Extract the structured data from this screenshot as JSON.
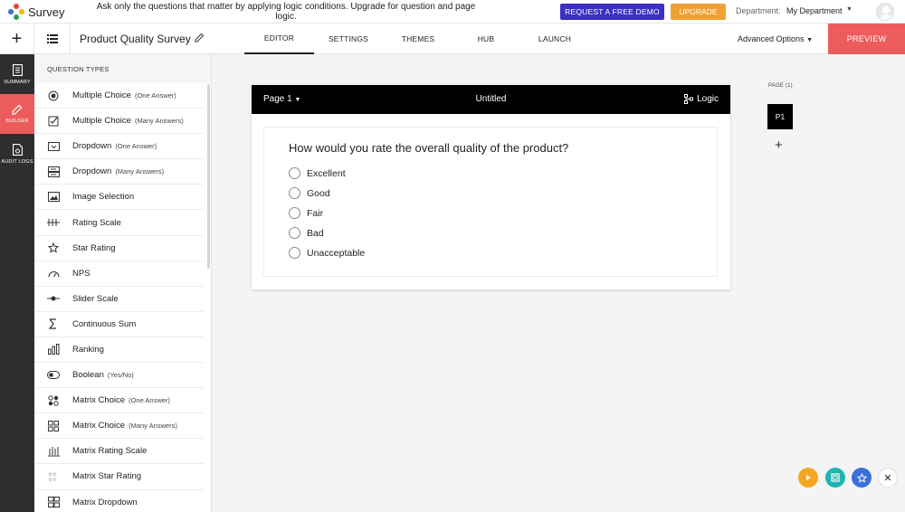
{
  "app": {
    "name": "Survey"
  },
  "topbar": {
    "promo": "Ask only the questions that matter by applying logic conditions. Upgrade for question and page logic.",
    "demo_button": "REQUEST A FREE DEMO",
    "upgrade_button": "UPGRADE",
    "department_label": "Department:",
    "department_value": "My Department"
  },
  "nav": {
    "survey_title": "Product Quality Survey",
    "tabs": [
      "EDITOR",
      "SETTINGS",
      "THEMES",
      "HUB",
      "LAUNCH"
    ],
    "active_tab": "EDITOR",
    "advanced_options": "Advanced Options",
    "preview": "PREVIEW"
  },
  "leftbar": {
    "items": [
      {
        "label": "SUMMARY",
        "icon": "document-icon"
      },
      {
        "label": "BUILDER",
        "icon": "pencil-icon"
      },
      {
        "label": "AUDIT LOGS",
        "icon": "log-file-icon"
      }
    ]
  },
  "question_types": {
    "header": "QUESTION TYPES",
    "items": [
      {
        "label": "Multiple Choice",
        "sub": "(One Answer)",
        "icon": "radio-icon"
      },
      {
        "label": "Multiple Choice",
        "sub": "(Many Answers)",
        "icon": "checkbox-icon"
      },
      {
        "label": "Dropdown",
        "sub": "(One Answer)",
        "icon": "dropdown-icon"
      },
      {
        "label": "Dropdown",
        "sub": "(Many Answers)",
        "icon": "multi-dropdown-icon"
      },
      {
        "label": "Image Selection",
        "sub": "",
        "icon": "image-icon"
      },
      {
        "label": "Rating Scale",
        "sub": "",
        "icon": "rating-scale-icon"
      },
      {
        "label": "Star Rating",
        "sub": "",
        "icon": "star-icon"
      },
      {
        "label": "NPS",
        "sub": "",
        "icon": "gauge-icon"
      },
      {
        "label": "Slider Scale",
        "sub": "",
        "icon": "slider-icon"
      },
      {
        "label": "Continuous Sum",
        "sub": "",
        "icon": "sigma-icon"
      },
      {
        "label": "Ranking",
        "sub": "",
        "icon": "ranking-icon"
      },
      {
        "label": "Boolean",
        "sub": "(Yes/No)",
        "icon": "toggle-icon"
      },
      {
        "label": "Matrix Choice",
        "sub": "(One Answer)",
        "icon": "matrix-radio-icon"
      },
      {
        "label": "Matrix Choice",
        "sub": "(Many Answers)",
        "icon": "matrix-checkbox-icon"
      },
      {
        "label": "Matrix Rating Scale",
        "sub": "",
        "icon": "matrix-rating-icon"
      },
      {
        "label": "Matrix Star Rating",
        "sub": "",
        "icon": "matrix-star-icon"
      },
      {
        "label": "Matrix Dropdown",
        "sub": "",
        "icon": "matrix-dropdown-icon"
      }
    ]
  },
  "editor": {
    "page_selector": "Page 1",
    "page_title": "Untitled",
    "logic": "Logic",
    "question": "How would you rate the overall quality of the product?",
    "options": [
      "Excellent",
      "Good",
      "Fair",
      "Bad",
      "Unacceptable"
    ]
  },
  "pages": {
    "label": "PAGE (1)",
    "chip": "P1"
  },
  "colors": {
    "preview": "#ec5c5c",
    "demo": "#3b2fc4",
    "upgrade": "#f0a134",
    "fab_orange": "#f5a623",
    "fab_teal": "#1fb5b0",
    "fab_blue": "#3b6fd9"
  }
}
